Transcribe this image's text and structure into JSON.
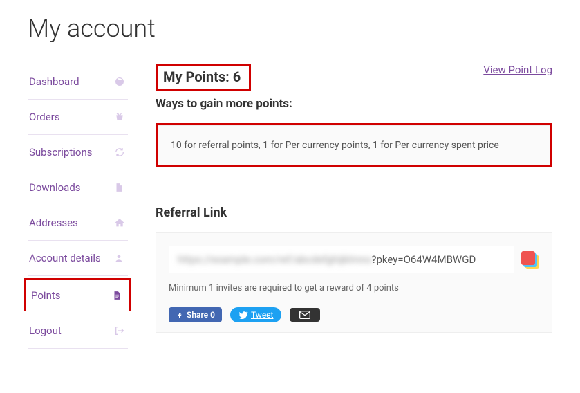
{
  "page_title": "My account",
  "sidebar": {
    "items": [
      {
        "label": "Dashboard",
        "icon": "dashboard-icon"
      },
      {
        "label": "Orders",
        "icon": "basket-icon"
      },
      {
        "label": "Subscriptions",
        "icon": "refresh-icon"
      },
      {
        "label": "Downloads",
        "icon": "file-icon"
      },
      {
        "label": "Addresses",
        "icon": "home-icon"
      },
      {
        "label": "Account details",
        "icon": "user-icon"
      },
      {
        "label": "Points",
        "icon": "document-icon"
      },
      {
        "label": "Logout",
        "icon": "signout-icon"
      }
    ]
  },
  "header": {
    "my_points_label": "My Points: 6",
    "view_log": "View Point Log"
  },
  "ways": {
    "title": "Ways to gain more points:",
    "text": "10 for referral points, 1 for Per currency points, 1 for Per currency spent price"
  },
  "referral": {
    "title": "Referral Link",
    "link_visible": "?pkey=O64W4MBWGD",
    "min_text": "Minimum 1 invites are required to get a reward of 4 points"
  },
  "share": {
    "fb": "Share 0",
    "tw": "Tweet"
  }
}
